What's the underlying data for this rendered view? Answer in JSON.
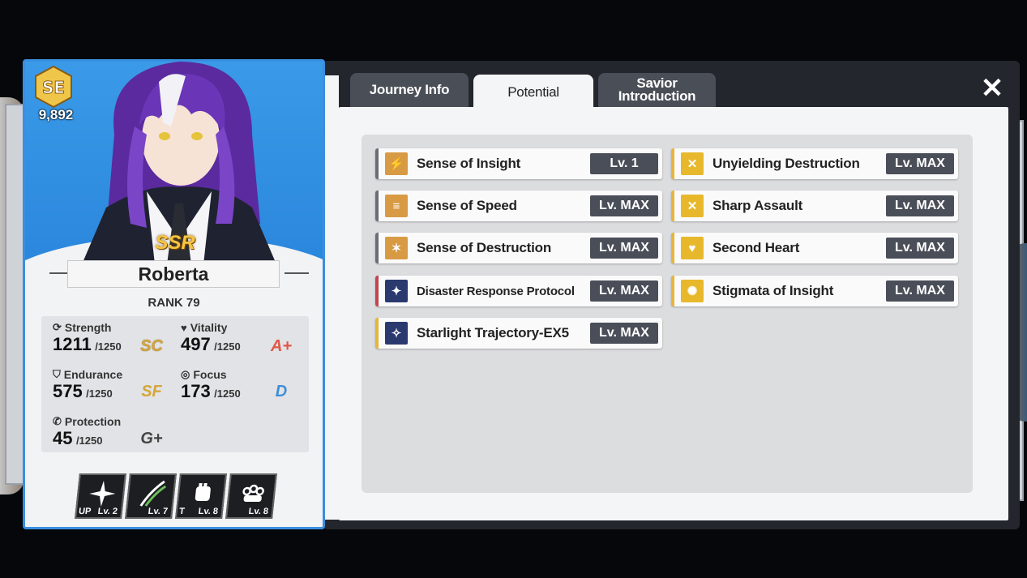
{
  "character": {
    "badge": "SE",
    "score": "9,892",
    "rarity": "SSR",
    "name": "Roberta",
    "rank": "RANK 79",
    "stats": [
      {
        "label": "Strength",
        "value": "1211",
        "max": "/1250",
        "grade": "SC",
        "icon": "strength-icon"
      },
      {
        "label": "Vitality",
        "value": "497",
        "max": "/1250",
        "grade": "A+",
        "icon": "heart-icon"
      },
      {
        "label": "Endurance",
        "value": "575",
        "max": "/1250",
        "grade": "SF",
        "icon": "shield-icon"
      },
      {
        "label": "Focus",
        "value": "173",
        "max": "/1250",
        "grade": "D",
        "icon": "focus-icon"
      },
      {
        "label": "Protection",
        "value": "45",
        "max": "/1250",
        "grade": "G+",
        "icon": "protection-icon"
      }
    ],
    "skills": [
      {
        "tag": "UP",
        "level": "Lv. 2",
        "icon": "star-burst-icon"
      },
      {
        "tag": "",
        "level": "Lv. 7",
        "icon": "blade-slash-icon"
      },
      {
        "tag": "T",
        "level": "Lv. 8",
        "icon": "fist-icon"
      },
      {
        "tag": "",
        "level": "Lv. 8",
        "icon": "knuckle-icon"
      }
    ]
  },
  "tabs": {
    "journey": "Journey Info",
    "potential": "Potential",
    "savior_line1": "Savior",
    "savior_line2": "Introduction",
    "close": "✕"
  },
  "potentials_left": [
    {
      "name": "Sense of Insight",
      "level": "Lv. 1"
    },
    {
      "name": "Sense of Speed",
      "level": "Lv. MAX"
    },
    {
      "name": "Sense of Destruction",
      "level": "Lv. MAX"
    },
    {
      "name": "Disaster Response Protocol",
      "level": "Lv. MAX"
    },
    {
      "name": "Starlight Trajectory-EX5",
      "level": "Lv. MAX"
    }
  ],
  "potentials_right": [
    {
      "name": "Unyielding Destruction",
      "level": "Lv. MAX"
    },
    {
      "name": "Sharp Assault",
      "level": "Lv. MAX"
    },
    {
      "name": "Second Heart",
      "level": "Lv. MAX"
    },
    {
      "name": "Stigmata of Insight",
      "level": "Lv. MAX"
    }
  ],
  "colors": {
    "accent_blue": "#3a8ee0",
    "gold": "#e8b43a",
    "navy": "#2b3a6e",
    "level_badge": "#4a4e58"
  }
}
